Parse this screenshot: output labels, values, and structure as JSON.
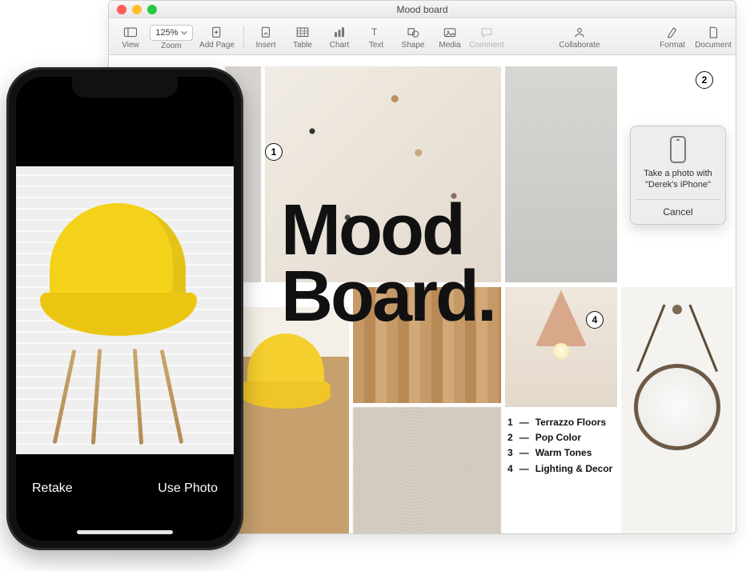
{
  "window": {
    "title": "Mood board"
  },
  "toolbar": {
    "view": "View",
    "zoom_value": "125%",
    "zoom_label": "Zoom",
    "add_page": "Add Page",
    "insert": "Insert",
    "table": "Table",
    "chart": "Chart",
    "text": "Text",
    "shape": "Shape",
    "media": "Media",
    "comment": "Comment",
    "collaborate": "Collaborate",
    "format": "Format",
    "document": "Document"
  },
  "doc": {
    "headline_l1": "Mood",
    "headline_l2": "Board.",
    "badges": {
      "b1": "1",
      "b2": "2",
      "b4": "4"
    },
    "list": [
      {
        "n": "1",
        "label": "Terrazzo Floors"
      },
      {
        "n": "2",
        "label": "Pop Color"
      },
      {
        "n": "3",
        "label": "Warm Tones"
      },
      {
        "n": "4",
        "label": "Lighting & Decor"
      }
    ]
  },
  "popover": {
    "line": "Take a photo with \"Derek's iPhone\"",
    "cancel": "Cancel"
  },
  "iphone": {
    "retake": "Retake",
    "use_photo": "Use Photo"
  }
}
